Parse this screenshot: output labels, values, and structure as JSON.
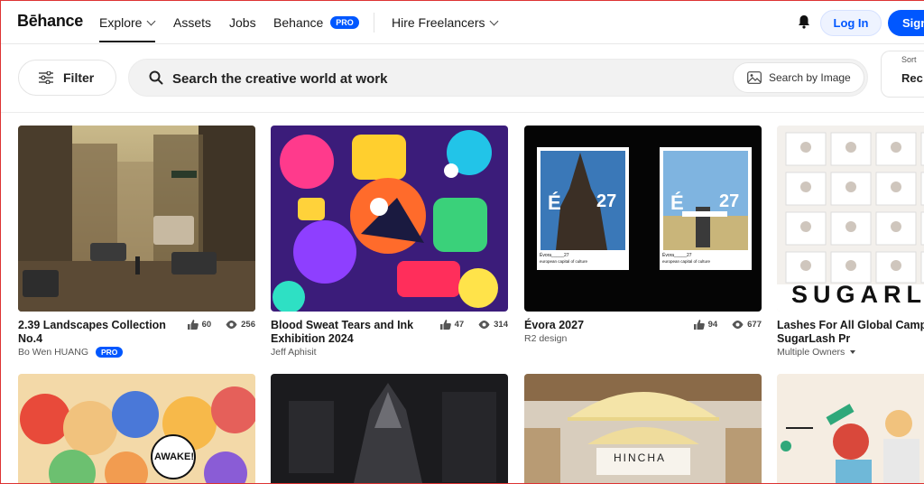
{
  "nav": {
    "logo": "Bēhance",
    "items": [
      {
        "label": "Explore"
      },
      {
        "label": "Assets"
      },
      {
        "label": "Jobs"
      },
      {
        "label": "Behance",
        "badge": "PRO"
      },
      {
        "label": "Hire Freelancers"
      }
    ],
    "login_label": "Log In",
    "signup_label": "Sign"
  },
  "search": {
    "filter_label": "Filter",
    "placeholder": "Search the creative world at work",
    "image_search_label": "Search by Image",
    "sort_label": "Sort",
    "sort_value": "Rec"
  },
  "projects": [
    {
      "title": "2.39 Landscapes Collection No.4",
      "owner": "Bo Wen HUANG",
      "owner_badge": "PRO",
      "likes": "60",
      "views": "256"
    },
    {
      "title": "Blood Sweat Tears and Ink Exhibition 2024",
      "owner": "Jeff Aphisit",
      "likes": "47",
      "views": "314"
    },
    {
      "title": "Évora 2027",
      "owner": "R2 design",
      "likes": "94",
      "views": "677"
    },
    {
      "title": "Lashes For All Global Campaign for SugarLash Pr",
      "owner": "Multiple Owners"
    }
  ],
  "thumb_text": {
    "evora_letter": "É",
    "evora_year": "27",
    "evora_caption_left": "Évora_____27",
    "evora_caption_sub": "european capital of culture",
    "sugar": "SUGARL",
    "awake": "AWAKE!",
    "hincha": "HINCHA"
  },
  "colors": {
    "accent": "#0057ff",
    "text": "#191919"
  }
}
